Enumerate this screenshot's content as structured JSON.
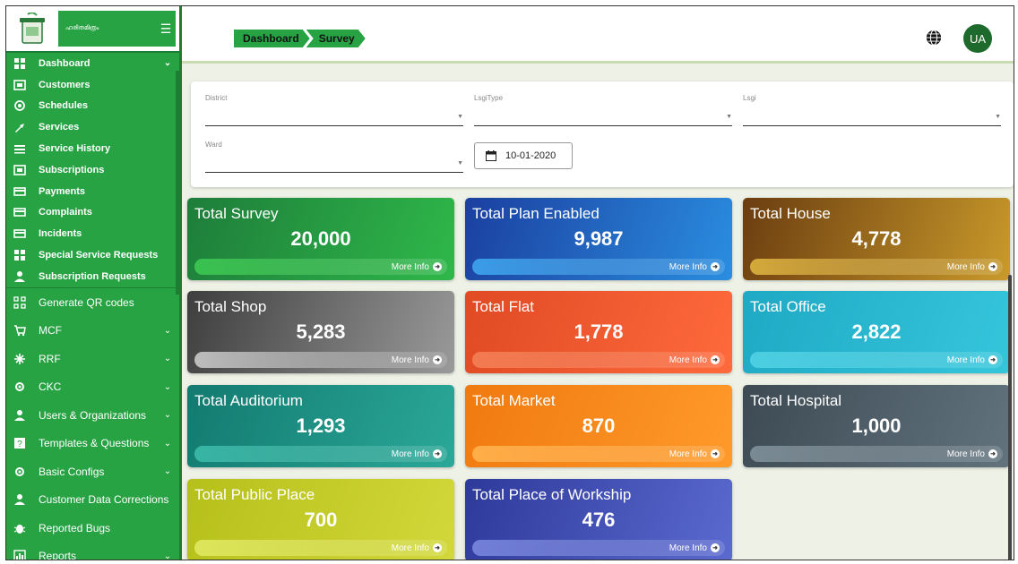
{
  "sidebar": {
    "brand_text": "ഹരിതമിത്രം",
    "items": [
      {
        "label": "Dashboard",
        "icon": "dashboard-icon",
        "chevron": true,
        "size": "small"
      },
      {
        "label": "Customers",
        "icon": "customers-icon",
        "chevron": false,
        "size": "small"
      },
      {
        "label": "Schedules",
        "icon": "schedules-icon",
        "chevron": false,
        "size": "small"
      },
      {
        "label": "Services",
        "icon": "services-icon",
        "chevron": false,
        "size": "small"
      },
      {
        "label": "Service History",
        "icon": "service-history-icon",
        "chevron": false,
        "size": "small"
      },
      {
        "label": "Subscriptions",
        "icon": "subscriptions-icon",
        "chevron": false,
        "size": "small"
      },
      {
        "label": "Payments",
        "icon": "payments-icon",
        "chevron": false,
        "size": "small"
      },
      {
        "label": "Complaints",
        "icon": "complaints-icon",
        "chevron": false,
        "size": "small"
      },
      {
        "label": "Incidents",
        "icon": "incidents-icon",
        "chevron": false,
        "size": "small"
      },
      {
        "label": "Special Service Requests",
        "icon": "special-requests-icon",
        "chevron": false,
        "size": "small"
      },
      {
        "label": "Subscription Requests",
        "icon": "subscription-requests-icon",
        "chevron": false,
        "size": "small"
      },
      {
        "label": "Generate QR codes",
        "icon": "qr-code-icon",
        "chevron": false,
        "size": "big"
      },
      {
        "label": "MCF",
        "icon": "mcf-icon",
        "chevron": true,
        "size": "big"
      },
      {
        "label": "RRF",
        "icon": "rrf-icon",
        "chevron": true,
        "size": "big"
      },
      {
        "label": "CKC",
        "icon": "ckc-icon",
        "chevron": true,
        "size": "big"
      },
      {
        "label": "Users & Organizations",
        "icon": "users-icon",
        "chevron": true,
        "size": "big"
      },
      {
        "label": "Templates & Questions",
        "icon": "templates-icon",
        "chevron": true,
        "size": "big"
      },
      {
        "label": "Basic Configs",
        "icon": "configs-icon",
        "chevron": true,
        "size": "big"
      },
      {
        "label": "Customer Data Corrections",
        "icon": "data-corrections-icon",
        "chevron": false,
        "size": "big"
      },
      {
        "label": "Reported Bugs",
        "icon": "bug-icon",
        "chevron": false,
        "size": "big"
      },
      {
        "label": "Reports",
        "icon": "reports-icon",
        "chevron": true,
        "size": "big"
      }
    ]
  },
  "header": {
    "breadcrumbs": [
      "Dashboard",
      "Survey"
    ],
    "avatar_initials": "UA"
  },
  "filters": {
    "district_label": "District",
    "lsgi_type_label": "LsgiType",
    "lsgi_label": "Lsgi",
    "ward_label": "Ward",
    "date_value": "10-01-2020"
  },
  "cards": [
    {
      "title": "Total Survey",
      "value": "20,000",
      "more": "More Info",
      "color_from": "#1e7d3a",
      "color_to": "#2fb84a",
      "footer": "#39c24f"
    },
    {
      "title": "Total Plan Enabled",
      "value": "9,987",
      "more": "More Info",
      "color_from": "#1b3fa0",
      "color_to": "#2a8ee0",
      "footer": "#3a9de8"
    },
    {
      "title": "Total House",
      "value": "4,778",
      "more": "More Info",
      "color_from": "#6b3d10",
      "color_to": "#c99a2a",
      "footer": "#d4a93a"
    },
    {
      "title": "Total Shop",
      "value": "5,283",
      "more": "More Info",
      "color_from": "#3e3e3e",
      "color_to": "#9a9a9a",
      "footer": "#bdbdbd"
    },
    {
      "title": "Total Flat",
      "value": "1,778",
      "more": "More Info",
      "color_from": "#e04a24",
      "color_to": "#ff6a3c",
      "footer": "#f27a50"
    },
    {
      "title": "Total Office",
      "value": "2,822",
      "more": "More Info",
      "color_from": "#1fa9c4",
      "color_to": "#35c6dc",
      "footer": "#4ccfe2"
    },
    {
      "title": "Total Auditorium",
      "value": "1,293",
      "more": "More Info",
      "color_from": "#137a70",
      "color_to": "#2aa898",
      "footer": "#38b5a5"
    },
    {
      "title": "Total Market",
      "value": "870",
      "more": "More Info",
      "color_from": "#f07a10",
      "color_to": "#ff9a2a",
      "footer": "#ffae48"
    },
    {
      "title": "Total Hospital",
      "value": "1,000",
      "more": "More Info",
      "color_from": "#3d4a53",
      "color_to": "#62737e",
      "footer": "#7a8a94"
    },
    {
      "title": "Total Public Place",
      "value": "700",
      "more": "More Info",
      "color_from": "#b6c01a",
      "color_to": "#d2d83a",
      "footer": "#dde55a"
    },
    {
      "title": "Total Place of Workship",
      "value": "476",
      "more": "More Info",
      "color_from": "#2e3a9a",
      "color_to": "#5b6ad0",
      "footer": "#7380d8"
    }
  ]
}
